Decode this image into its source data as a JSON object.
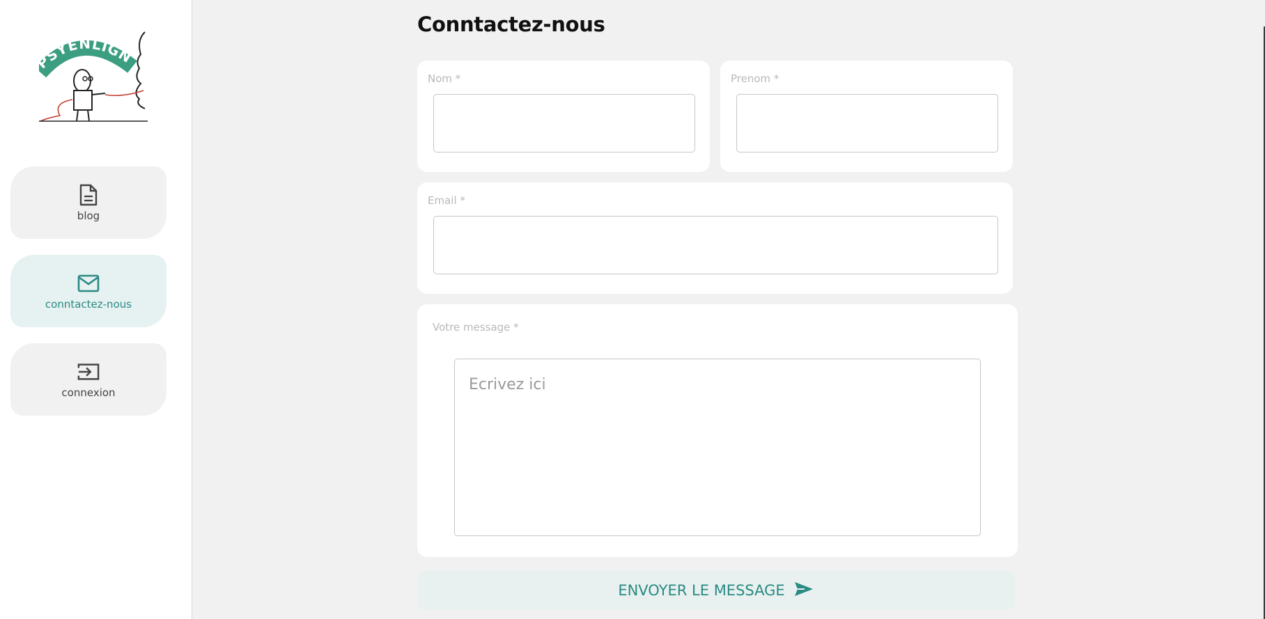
{
  "brand": {
    "logo_text": "PSYENLIGNE"
  },
  "sidebar": {
    "items": [
      {
        "label": "blog",
        "icon": "document-icon",
        "active": false
      },
      {
        "label": "conntactez-nous",
        "icon": "mail-icon",
        "active": true
      },
      {
        "label": "connexion",
        "icon": "login-icon",
        "active": false
      }
    ]
  },
  "main": {
    "title": "Conntactez-nous",
    "form": {
      "nom_label": "Nom *",
      "prenom_label": "Prenom *",
      "email_label": "Email *",
      "message_label": "Votre message *",
      "message_placeholder": "Ecrivez ici",
      "submit_label": "ENVOYER LE MESSAGE"
    }
  },
  "colors": {
    "accent": "#2a8a84",
    "background": "#f1f1f1",
    "active_nav": "#e6f1f1"
  }
}
